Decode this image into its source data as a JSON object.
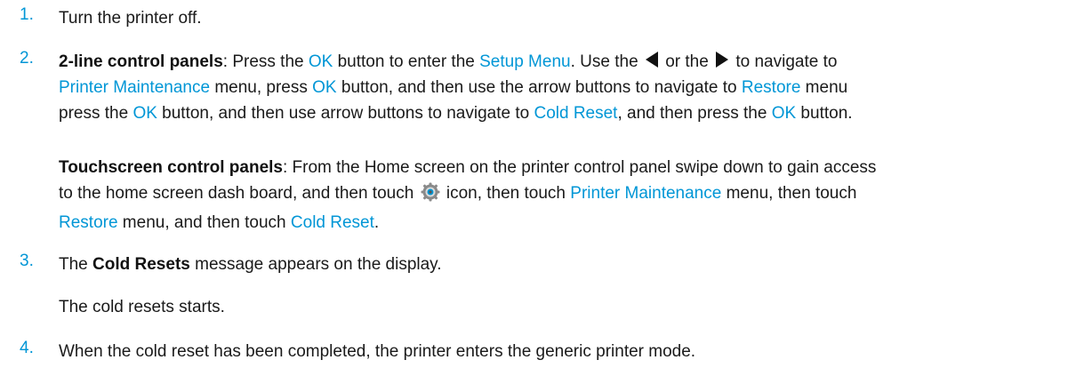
{
  "steps": [
    {
      "number": "1.",
      "text": "Turn the printer off."
    },
    {
      "number": "2.",
      "twoline": {
        "heading": "2-line control panels",
        "t1": ": Press the ",
        "ok": "OK",
        "t2": " button to enter the ",
        "setup_menu": "Setup Menu",
        "t3": ". Use the ",
        "t4": " or the ",
        "t5": " to navigate to",
        "printer_maintenance": "Printer Maintenance",
        "t6": " menu, press ",
        "t7": " button, and then use the arrow buttons to navigate to ",
        "restore": "Restore",
        "t8": " menu",
        "t9": "press the ",
        "t10": " button, and then use arrow buttons to navigate to ",
        "cold_reset": "Cold Reset",
        "t11": ", and then press the ",
        "t12": " button."
      },
      "touch": {
        "heading": "Touchscreen control panels",
        "t1": ": From the Home screen on the printer control panel swipe down to gain access",
        "t2": "to the home screen dash board, and then touch ",
        "t3": " icon, then touch ",
        "printer_maintenance": "Printer Maintenance",
        "t4": " menu, then touch",
        "restore": "Restore",
        "t5": " menu, and then touch ",
        "cold_reset": "Cold Reset",
        "t6": "."
      }
    },
    {
      "number": "3.",
      "t1": "The ",
      "bold": "Cold Resets",
      "t2": " message appears on the display.",
      "sub": "The cold resets starts."
    },
    {
      "number": "4.",
      "text": "When the cold reset has been completed, the printer enters the generic printer mode."
    }
  ],
  "colors": {
    "link": "#0096d6",
    "text": "#1a1a1a"
  },
  "icons": [
    "left-arrow-icon",
    "right-arrow-icon",
    "settings-gear-icon"
  ]
}
